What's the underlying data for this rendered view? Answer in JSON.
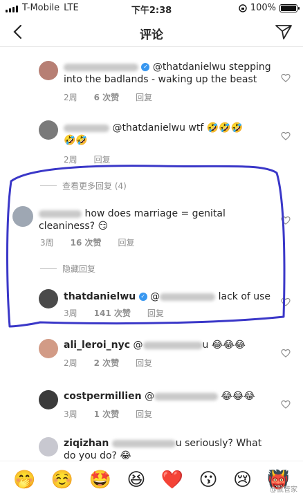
{
  "status_bar": {
    "carrier": "T-Mobile",
    "network": "LTE",
    "time": "下午2:38",
    "battery_text": "100%",
    "battery_level": 1.0
  },
  "nav": {
    "title": "评论",
    "back_icon": "chevron-left-icon",
    "share_icon": "direct-send-icon"
  },
  "comments": [
    {
      "mention": "@thatdanielwu",
      "text_line1": "stepping",
      "text_line2": "into the badlands - waking up the beast",
      "time": "2周",
      "likes": "6 次赞",
      "reply": "回复"
    },
    {
      "mention": "@thatdanielwu",
      "text": "wtf",
      "emojis_line1": "🤣🤣🤣",
      "emojis_line2": "🤣🤣",
      "time": "2周",
      "likes": "",
      "reply": "回复"
    }
  ],
  "view_more_replies": "查看更多回复 (4)",
  "reply_marriage": {
    "text_line1": "how does marriage = genital",
    "text_line2": "cleaniness?",
    "emoji": "😏",
    "time": "3周",
    "likes": "16 次赞",
    "reply": "回复"
  },
  "hide_replies": "隐藏回复",
  "reply_daniel": {
    "username": "thatdanielwu",
    "mention_prefix": "@",
    "text": "lack of use",
    "time": "3周",
    "likes": "141 次赞",
    "reply": "回复"
  },
  "comment_ali": {
    "username": "ali_leroi_nyc",
    "mention_prefix": "@",
    "mention_suffix": "u",
    "emojis": "😂😂😂",
    "time": "2周",
    "likes": "2 次赞",
    "reply": "回复"
  },
  "comment_cost": {
    "username": "costpermillien",
    "mention_prefix": "@",
    "emojis": "😂😂😂",
    "time": "3周",
    "likes": "1 次赞",
    "reply": "回复"
  },
  "comment_ziq": {
    "username": "ziqizhan",
    "text_line1_suffix": "u seriously? What",
    "text_line2": "do you do?",
    "emojis": "😂"
  },
  "emoji_bar": [
    "🤭",
    "☺️",
    "🤩",
    "😆",
    "❤️",
    "😗",
    "😢",
    "👹"
  ],
  "watermark": "@鼠管家",
  "colors": {
    "annotation": "#3a37c8",
    "verified": "#3897f0",
    "meta": "#8e8e8e"
  }
}
